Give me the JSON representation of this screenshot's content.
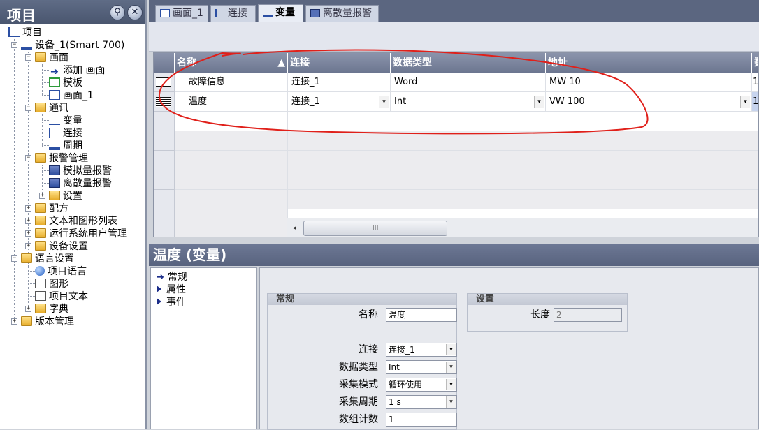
{
  "left_panel": {
    "title": "项目",
    "pin_glyph": "⚲",
    "close_glyph": "✕",
    "tree": [
      {
        "label": "项目",
        "icon": "project-icon"
      },
      {
        "label": "设备_1(Smart 700)",
        "icon": "device-icon"
      },
      {
        "label": "画面",
        "icon": "folder-icon"
      },
      {
        "label": "添加 画面",
        "icon": "add-screen-icon"
      },
      {
        "label": "模板",
        "icon": "template-icon"
      },
      {
        "label": "画面_1",
        "icon": "screen-icon"
      },
      {
        "label": "通讯",
        "icon": "folder-icon"
      },
      {
        "label": "变量",
        "icon": "tag-icon"
      },
      {
        "label": "连接",
        "icon": "connection-icon"
      },
      {
        "label": "周期",
        "icon": "cycle-icon"
      },
      {
        "label": "报警管理",
        "icon": "folder-icon"
      },
      {
        "label": "模拟量报警",
        "icon": "analog-alarm-icon"
      },
      {
        "label": "离散量报警",
        "icon": "discrete-alarm-icon"
      },
      {
        "label": "设置",
        "icon": "folder-icon"
      },
      {
        "label": "配方",
        "icon": "folder-icon"
      },
      {
        "label": "文本和图形列表",
        "icon": "folder-icon"
      },
      {
        "label": "运行系统用户管理",
        "icon": "folder-icon"
      },
      {
        "label": "设备设置",
        "icon": "folder-icon"
      },
      {
        "label": "语言设置",
        "icon": "folder-icon"
      },
      {
        "label": "项目语言",
        "icon": "globe-icon"
      },
      {
        "label": "图形",
        "icon": "graphics-icon"
      },
      {
        "label": "项目文本",
        "icon": "text-icon"
      },
      {
        "label": "字典",
        "icon": "folder-icon"
      },
      {
        "label": "版本管理",
        "icon": "folder-icon"
      }
    ]
  },
  "tabs": [
    {
      "label": "画面_1",
      "icon": "screen-icon"
    },
    {
      "label": "连接",
      "icon": "connection-icon"
    },
    {
      "label": "变量",
      "icon": "tag-icon"
    },
    {
      "label": "离散量报警",
      "icon": "discrete-alarm-icon"
    }
  ],
  "grid": {
    "columns": [
      "名称",
      "连接",
      "数据类型",
      "地址",
      "数"
    ],
    "rows": [
      {
        "name": "故障信息",
        "connection": "连接_1",
        "data_type": "Word",
        "address": "MW 10",
        "extra": "1"
      },
      {
        "name": "温度",
        "connection": "连接_1",
        "data_type": "Int",
        "address": "VW 100",
        "extra": "1"
      }
    ],
    "dropdown_glyph": "▾",
    "scroll_left_glyph": "◂",
    "scroll_thumb_glyph": "III"
  },
  "properties": {
    "title": "温度 (变量)",
    "nav": [
      "常规",
      "属性",
      "事件"
    ],
    "general_group": {
      "title": "常规",
      "fields": [
        {
          "label": "名称",
          "value": "温度"
        },
        {
          "label": "连接",
          "value": "连接_1"
        },
        {
          "label": "数据类型",
          "value": "Int"
        },
        {
          "label": "采集模式",
          "value": "循环使用"
        },
        {
          "label": "采集周期",
          "value": "1 s"
        },
        {
          "label": "数组计数",
          "value": "1"
        }
      ]
    },
    "settings_group": {
      "title": "设置",
      "length_label": "长度",
      "length_value": "2"
    }
  },
  "colors": {
    "annotation": "#e0201a",
    "header": "#5f6c86"
  }
}
